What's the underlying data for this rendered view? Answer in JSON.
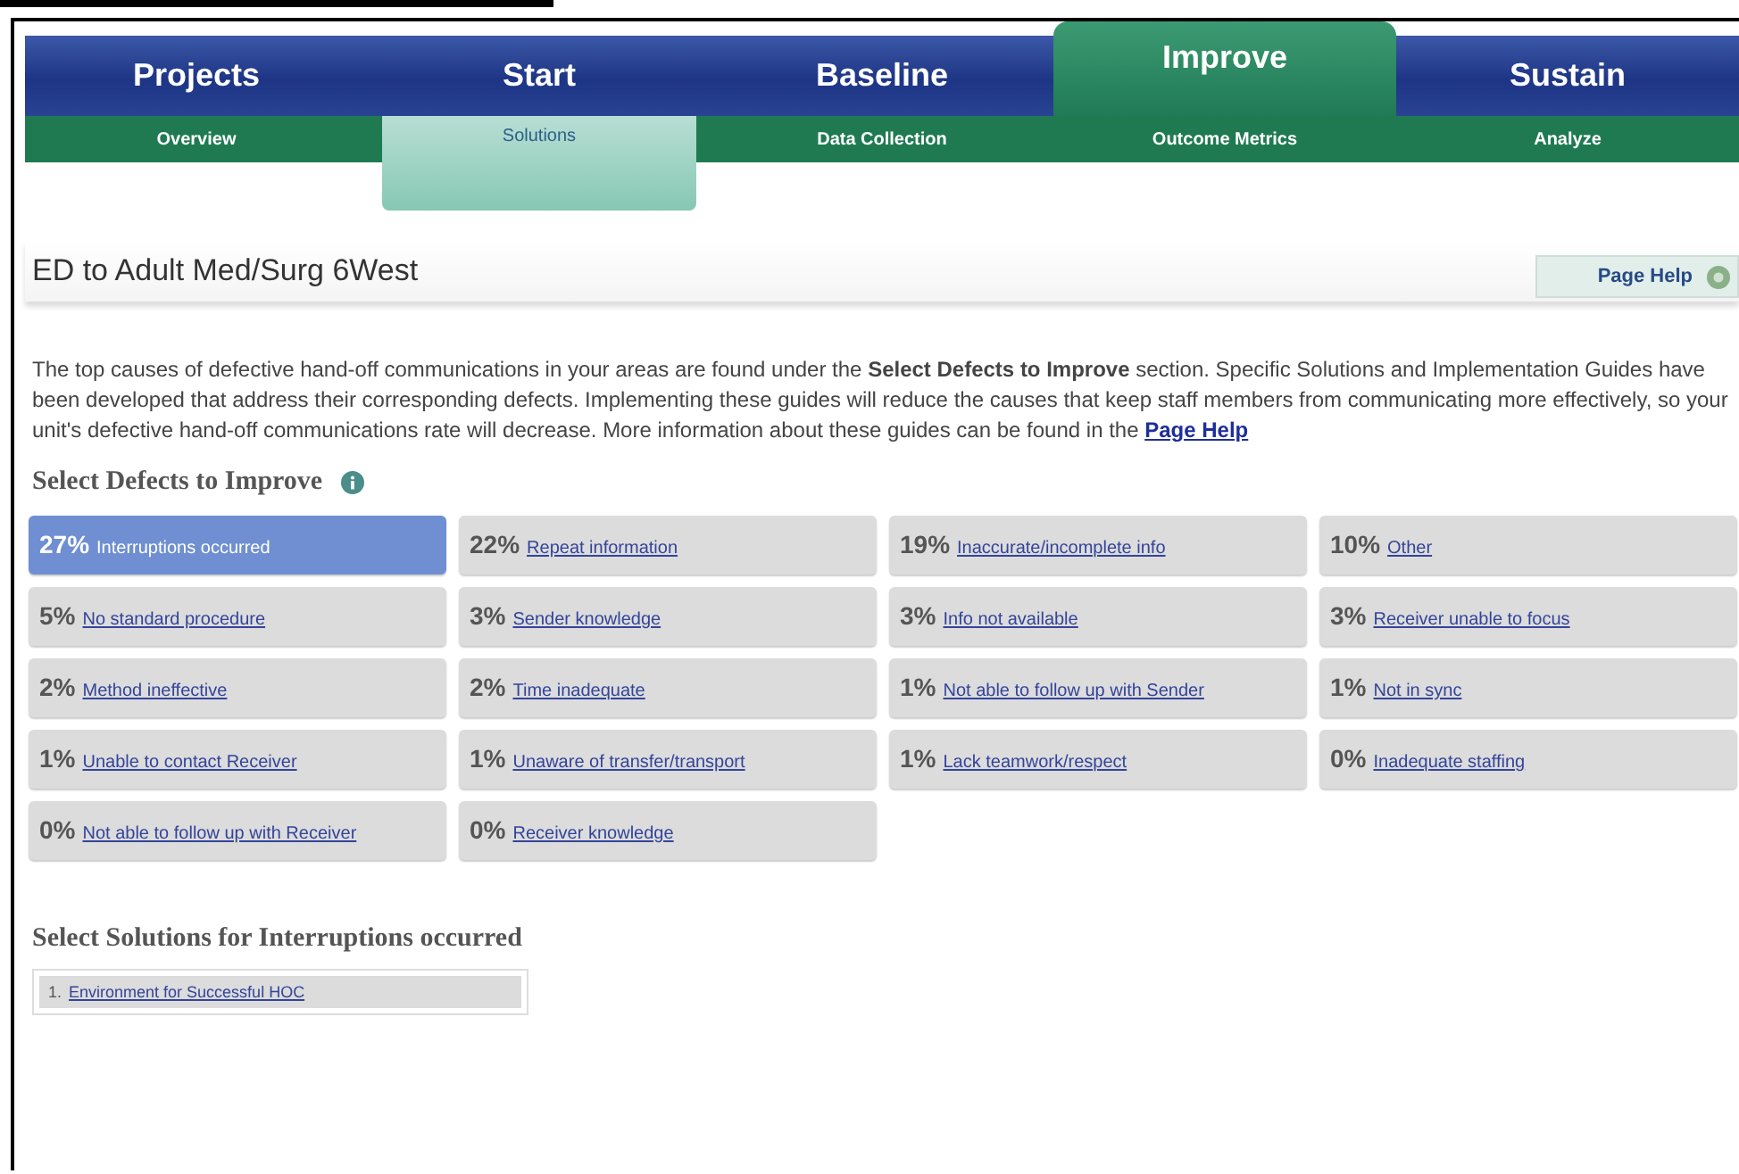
{
  "main_tabs": [
    {
      "label": "Projects",
      "selected": false
    },
    {
      "label": "Start",
      "selected": false
    },
    {
      "label": "Baseline",
      "selected": false
    },
    {
      "label": "Improve",
      "selected": true
    },
    {
      "label": "Sustain",
      "selected": false
    }
  ],
  "sub_tabs": [
    {
      "label": "Overview",
      "selected": false
    },
    {
      "label": "Solutions",
      "selected": true
    },
    {
      "label": "Data Collection",
      "selected": false
    },
    {
      "label": "Outcome Metrics",
      "selected": false
    },
    {
      "label": "Analyze",
      "selected": false
    }
  ],
  "page_title": "ED to Adult Med/Surg 6West",
  "page_help_button": "Page Help",
  "intro": {
    "text": "The top causes of defective hand-off communications in your areas are found under the **Select Defects to Improve** section. Specific Solutions and Implementation Guides have been developed that address their corresponding defects. Implementing these guides will reduce the causes that keep staff members from communicating more effectively, so your unit's defective hand-off communications rate will decrease. More information about these guides can be found in the",
    "link": "Page Help"
  },
  "defects_heading": "Select Defects to Improve",
  "defects": [
    {
      "percent": "27%",
      "label": "Interruptions occurred",
      "selected": true
    },
    {
      "percent": "22%",
      "label": "Repeat information",
      "selected": false
    },
    {
      "percent": "19%",
      "label": "Inaccurate/incomplete info",
      "selected": false
    },
    {
      "percent": "10%",
      "label": "Other",
      "selected": false
    },
    {
      "percent": "5%",
      "label": "No standard procedure",
      "selected": false
    },
    {
      "percent": "3%",
      "label": "Sender knowledge",
      "selected": false
    },
    {
      "percent": "3%",
      "label": "Info not available",
      "selected": false
    },
    {
      "percent": "3%",
      "label": "Receiver unable to focus",
      "selected": false
    },
    {
      "percent": "2%",
      "label": "Method ineffective",
      "selected": false
    },
    {
      "percent": "2%",
      "label": "Time inadequate",
      "selected": false
    },
    {
      "percent": "1%",
      "label": "Not able to follow up with Sender",
      "selected": false
    },
    {
      "percent": "1%",
      "label": "Not in sync",
      "selected": false
    },
    {
      "percent": "1%",
      "label": "Unable to contact Receiver",
      "selected": false
    },
    {
      "percent": "1%",
      "label": "Unaware of transfer/transport",
      "selected": false
    },
    {
      "percent": "1%",
      "label": "Lack teamwork/respect",
      "selected": false
    },
    {
      "percent": "0%",
      "label": "Inadequate staffing",
      "selected": false
    },
    {
      "percent": "0%",
      "label": "Not able to follow up with Receiver",
      "selected": false
    },
    {
      "percent": "0%",
      "label": "Receiver knowledge",
      "selected": false
    }
  ],
  "solutions_heading": "Select Solutions for Interruptions occurred",
  "solutions": [
    {
      "number": "1.",
      "label": "Environment for Successful HOC"
    }
  ]
}
